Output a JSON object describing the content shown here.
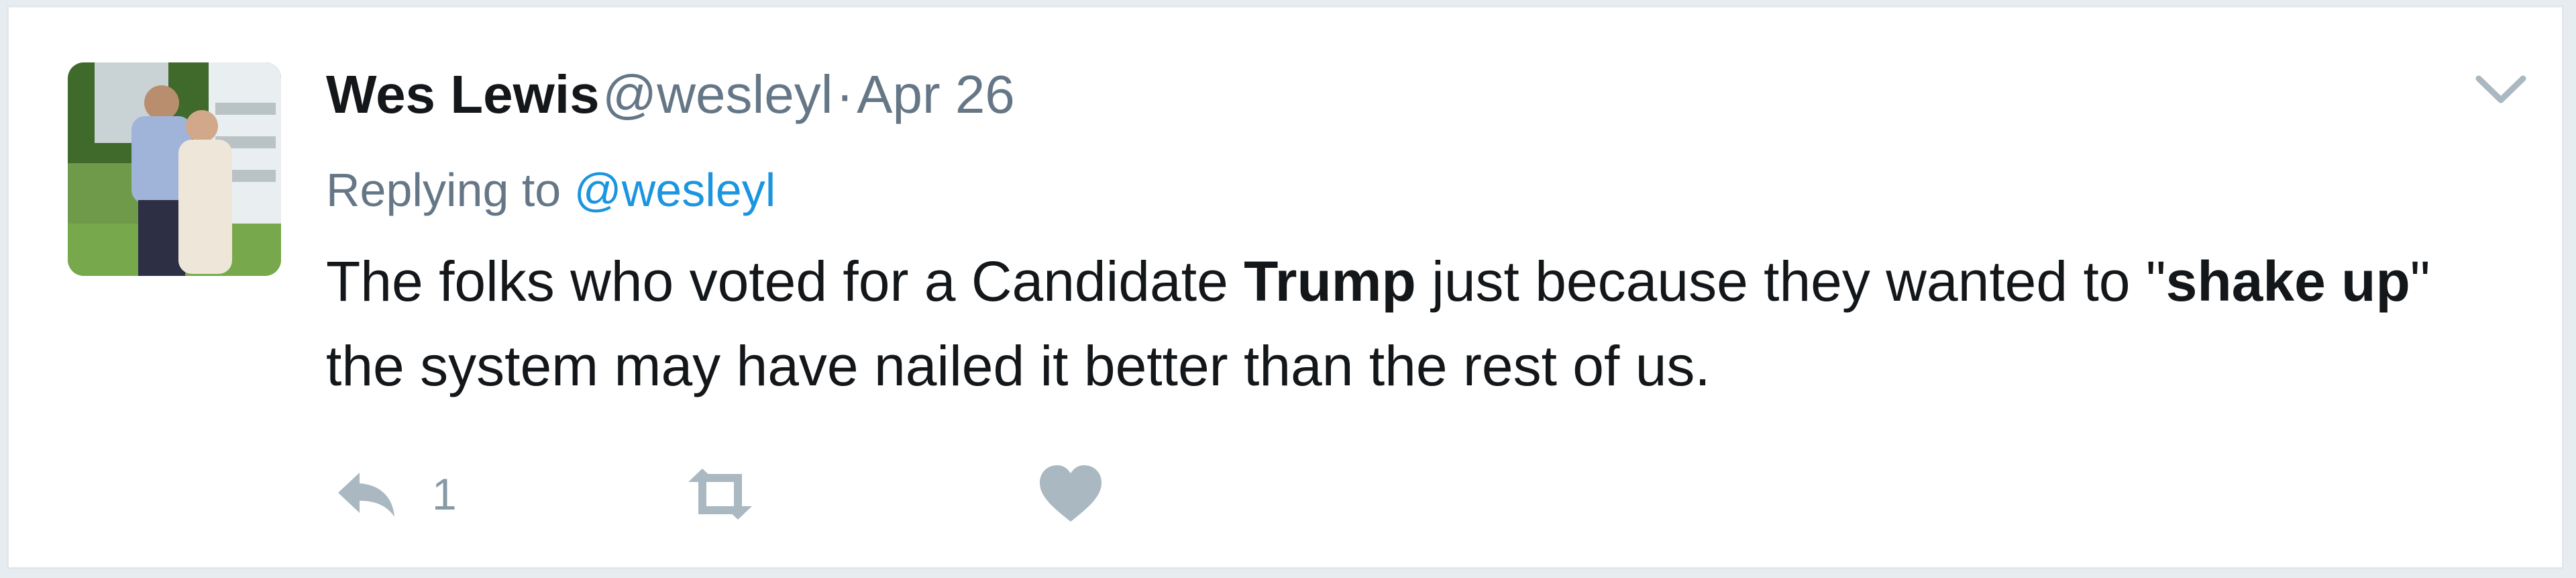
{
  "tweet": {
    "author_name": "Wes Lewis",
    "author_handle": "@wesleyl",
    "separator": "·",
    "date": "Apr 26",
    "replying_to_label": "Replying to",
    "replying_to_handle": "@wesleyl",
    "text": {
      "part1": "The folks who voted for a Candidate ",
      "bold1": "Trump",
      "part2": " just because they wanted to \"",
      "bold2": "shake up",
      "part3": "\" the system may have nailed it better than the rest of us."
    },
    "actions": {
      "reply_icon": "reply-icon",
      "reply_count": "1",
      "retweet_icon": "retweet-icon",
      "like_icon": "heart-icon"
    },
    "menu_icon": "chevron-down-icon"
  },
  "colors": {
    "text_primary": "#14171a",
    "text_secondary": "#657786",
    "link": "#1b95e0",
    "action_icon": "#aab8c2",
    "border": "#e1e8ed"
  }
}
